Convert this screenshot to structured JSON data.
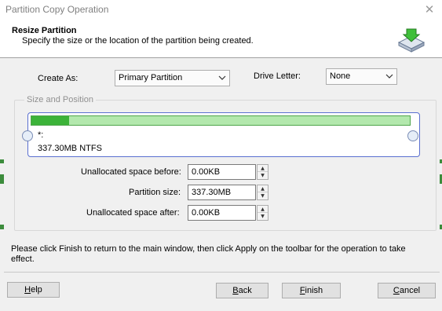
{
  "window": {
    "title": "Partition Copy Operation",
    "close_glyph": "✕"
  },
  "header": {
    "title": "Resize Partition",
    "description": "Specify the size or the location of the partition being created.",
    "icon": "partition-disk-icon"
  },
  "form": {
    "create_as_label": "Create As:",
    "create_as_value": "Primary Partition",
    "drive_letter_label": "Drive Letter:",
    "drive_letter_value": "None"
  },
  "size_position": {
    "legend": "Size and Position",
    "partition_name": "*:",
    "partition_info": "337.30MB NTFS",
    "used_fraction": 0.1
  },
  "fields": {
    "unalloc_before_label": "Unallocated space before:",
    "unalloc_before_value": "0.00KB",
    "partition_size_label": "Partition size:",
    "partition_size_value": "337.30MB",
    "unalloc_after_label": "Unallocated space after:",
    "unalloc_after_value": "0.00KB"
  },
  "info": "Please click Finish to return to the main window, then click Apply on the toolbar for the operation to take effect.",
  "buttons": {
    "help_first": "H",
    "help_rest": "elp",
    "back_first": "B",
    "back_rest": "ack",
    "finish_first": "F",
    "finish_rest": "inish",
    "cancel_first": "C",
    "cancel_rest": "ancel"
  },
  "colors": {
    "accent_green": "#3cb339",
    "bar_light_green": "#b3e8ad",
    "selection_border": "#5a6fd0"
  }
}
